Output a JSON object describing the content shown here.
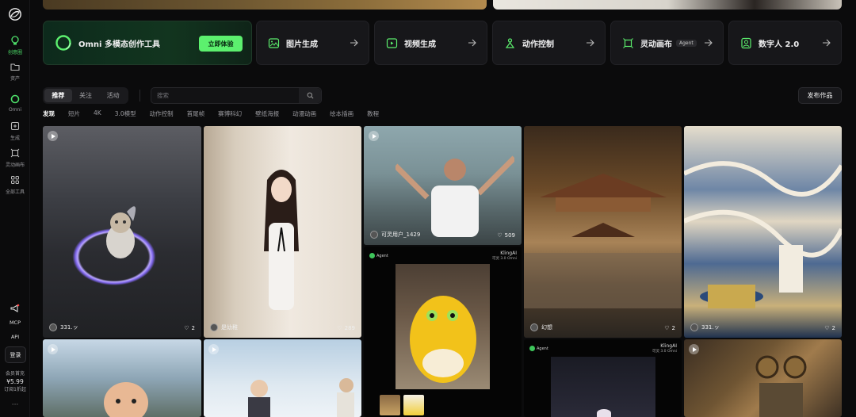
{
  "sidebar": {
    "items": [
      {
        "label": "创意圈",
        "icon": "lightbulb-icon"
      },
      {
        "label": "资产",
        "icon": "folder-icon"
      },
      {
        "label": "Omni",
        "icon": "omni-icon"
      },
      {
        "label": "生成",
        "icon": "generate-icon"
      },
      {
        "label": "灵动画布",
        "icon": "canvas-icon"
      },
      {
        "label": "全部工具",
        "icon": "grid-icon"
      },
      {
        "label": "",
        "icon": "megaphone-icon"
      },
      {
        "label": "MCP",
        "icon": "mcp-icon"
      },
      {
        "label": "API",
        "icon": "api-icon"
      }
    ],
    "login_label": "登录",
    "vip": {
      "title": "会员首充",
      "price": "¥5.99",
      "sub": "订阅1折起"
    },
    "more": "···"
  },
  "feature_cards": [
    {
      "label": "Omni 多模态创作工具",
      "button": "立即体验"
    },
    {
      "label": "图片生成",
      "icon": "image-icon"
    },
    {
      "label": "视频生成",
      "icon": "video-icon"
    },
    {
      "label": "动作控制",
      "icon": "motion-icon"
    },
    {
      "label": "灵动画布",
      "badge": "Agent",
      "icon": "canvas-icon"
    },
    {
      "label": "数字人 2.0",
      "icon": "avatar-icon"
    }
  ],
  "tabs": [
    "推荐",
    "关注",
    "活动"
  ],
  "search": {
    "placeholder": "搜索"
  },
  "publish_label": "发布作品",
  "categories": [
    "发现",
    "短片",
    "4K",
    "3.0模型",
    "动作控制",
    "首尾帧",
    "赛博科幻",
    "壁纸海报",
    "动漫动画",
    "绘本插画",
    "教程"
  ],
  "gallery": [
    {
      "user": "331.ッ",
      "likes": "2"
    },
    {
      "user": "是幼稚",
      "likes": "289"
    },
    {
      "user": "可灵用户_1429",
      "likes": "509"
    },
    {
      "brand": "KlingAI",
      "sub": "可灵 3.0 Omni"
    },
    {
      "user": "幻想",
      "likes": "2"
    },
    {
      "user": "331.ッ",
      "likes": "2"
    },
    {
      "brand": "KlingAI",
      "sub": "可灵 3.0 Omni"
    }
  ],
  "colors": {
    "accent": "#5cf06e",
    "background": "#0b0b0c",
    "card": "#17171a"
  }
}
